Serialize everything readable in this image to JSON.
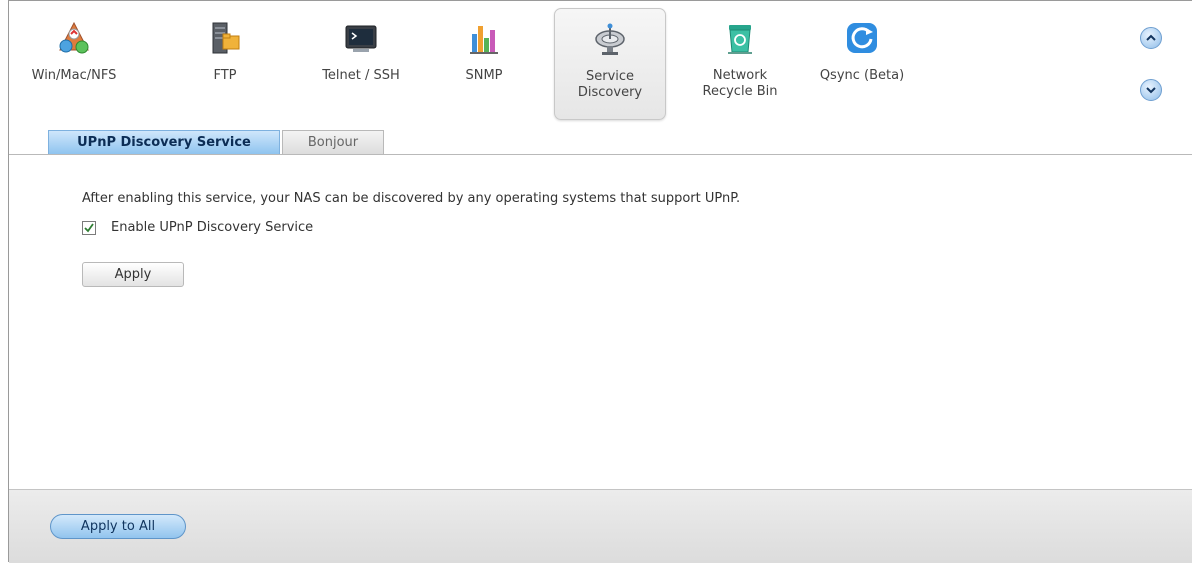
{
  "services": [
    {
      "label": "Win/Mac/NFS",
      "icon": "network-share-icon"
    },
    {
      "label": "FTP",
      "icon": "ftp-server-icon"
    },
    {
      "label": "Telnet / SSH",
      "icon": "terminal-icon"
    },
    {
      "label": "SNMP",
      "icon": "bar-chart-icon"
    },
    {
      "label": "Service\nDiscovery",
      "icon": "satellite-dish-icon",
      "selected": true
    },
    {
      "label": "Network\nRecycle Bin",
      "icon": "recycle-bin-icon"
    },
    {
      "label": "Qsync (Beta)",
      "icon": "sync-icon"
    }
  ],
  "nav": {
    "up_icon": "chevron-up-icon",
    "down_icon": "chevron-down-icon"
  },
  "tabs": [
    {
      "label": "UPnP Discovery Service",
      "active": true
    },
    {
      "label": "Bonjour",
      "active": false
    }
  ],
  "content": {
    "description": "After enabling this service, your NAS can be discovered by any operating systems that support UPnP.",
    "checkbox_label": "Enable UPnP Discovery Service",
    "checkbox_checked": true,
    "apply_label": "Apply"
  },
  "footer": {
    "apply_all_label": "Apply to All"
  },
  "colors": {
    "accent_blue": "#8fc4ef",
    "tab_active_text": "#0c2d55",
    "check_green": "#2e7d32"
  }
}
